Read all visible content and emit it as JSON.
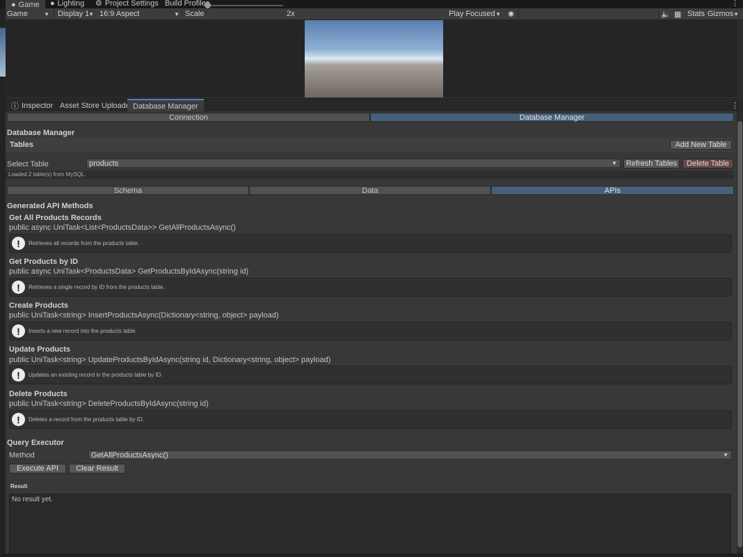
{
  "top_tabs": [
    {
      "label": "Game",
      "icon": "gamepad-icon"
    },
    {
      "label": "Lighting",
      "icon": "bulb-icon"
    },
    {
      "label": "Project Settings",
      "icon": "gear-icon"
    },
    {
      "label": "Build Profiles",
      "icon": ""
    }
  ],
  "game_toolbar": {
    "view": "Game",
    "display": "Display 1",
    "aspect": "16:9 Aspect",
    "scale_label": "Scale",
    "scale_value": "2x",
    "play_mode": "Play Focused",
    "stats": "Stats",
    "gizmos": "Gizmos"
  },
  "inspector_tabs": [
    {
      "label": "Inspector",
      "icon": "info-icon"
    },
    {
      "label": "Asset Store Uploader"
    },
    {
      "label": "Database Manager",
      "active": true
    }
  ],
  "main_tabs": [
    "Connection",
    "Database Manager"
  ],
  "db": {
    "title": "Database Manager",
    "tables_label": "Tables",
    "add_table": "Add New Table",
    "select_table_label": "Select Table",
    "selected_table": "products",
    "refresh": "Refresh Tables",
    "delete": "Delete Table",
    "status": "Loaded 2 table(s) from MySQL."
  },
  "sub_tabs": [
    "Schema",
    "Data",
    "APIs"
  ],
  "apis": {
    "title": "Generated API Methods",
    "methods": [
      {
        "name": "Get All Products Records",
        "signature": "public async UniTask<List<ProductsData>> GetAllProductsAsync()",
        "help": "Retrieves all records from the products table."
      },
      {
        "name": "Get Products by ID",
        "signature": "public async UniTask<ProductsData> GetProductsByIdAsync(string id)",
        "help": "Retrieves a single record by ID from the products table."
      },
      {
        "name": "Create Products",
        "signature": "public UniTask<string> InsertProductsAsync(Dictionary<string, object> payload)",
        "help": "Inserts a new record into the products table."
      },
      {
        "name": "Update Products",
        "signature": "public UniTask<string> UpdateProductsByIdAsync(string id, Dictionary<string, object> payload)",
        "help": "Updates an existing record in the products table by ID."
      },
      {
        "name": "Delete Products",
        "signature": "public UniTask<string> DeleteProductsByIdAsync(string id)",
        "help": "Deletes a record from the products table by ID."
      }
    ]
  },
  "query": {
    "title": "Query Executor",
    "method_label": "Method",
    "method_value": "GetAllProductsAsync()",
    "execute": "Execute API",
    "clear": "Clear Result",
    "result_label": "Result",
    "result_text": "No result yet."
  },
  "colors": {
    "accent": "#46607c",
    "panel": "#383838",
    "delete_button": "#6a4747"
  }
}
